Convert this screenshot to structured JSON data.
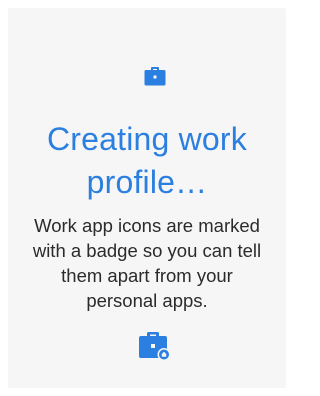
{
  "colors": {
    "accent": "#2b7fe0",
    "background": "#f6f6f6",
    "body_text": "#2b2b2b"
  },
  "icons": {
    "top": "work-briefcase-icon",
    "bottom": "work-badge-briefcase-icon"
  },
  "screen": {
    "title": "Creating work profile…",
    "description": "Work app icons are marked with a badge so you can tell them apart from your personal apps."
  }
}
